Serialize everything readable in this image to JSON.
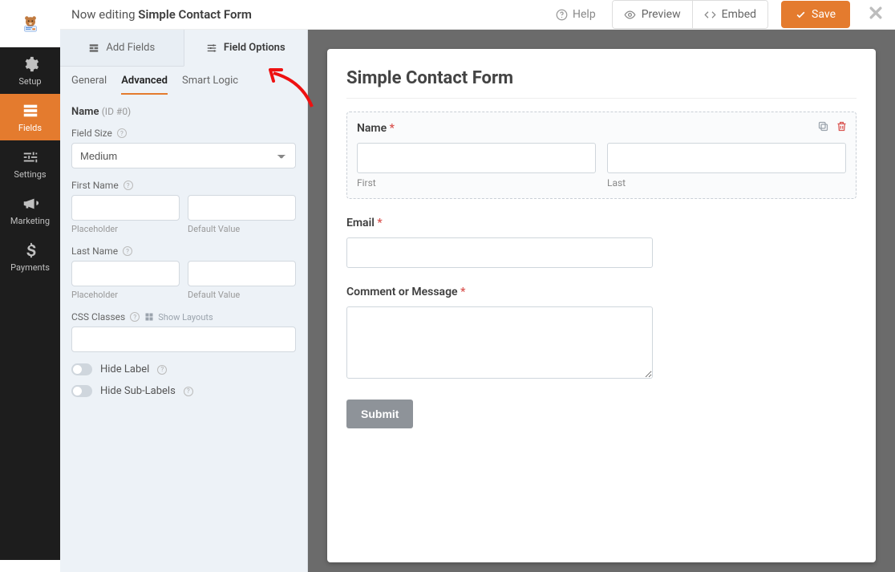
{
  "topbar": {
    "editing_prefix": "Now editing ",
    "form_name": "Simple Contact Form",
    "help": "Help",
    "preview": "Preview",
    "embed": "Embed",
    "save": "Save"
  },
  "rail": {
    "setup": "Setup",
    "fields": "Fields",
    "settings": "Settings",
    "marketing": "Marketing",
    "payments": "Payments"
  },
  "side": {
    "tab_add": "Add Fields",
    "tab_opts": "Field Options",
    "sub_general": "General",
    "sub_advanced": "Advanced",
    "sub_smart": "Smart Logic",
    "grp_name": "Name",
    "grp_idtag": "(ID #0)",
    "field_size": "Field Size",
    "field_size_value": "Medium",
    "first_name": "First Name",
    "last_name": "Last Name",
    "placeholder": "Placeholder",
    "default_value": "Default Value",
    "css_classes": "CSS Classes",
    "show_layouts": "Show Layouts",
    "hide_label": "Hide Label",
    "hide_sub": "Hide Sub-Labels"
  },
  "preview": {
    "title": "Simple Contact Form",
    "name_label": "Name",
    "first": "First",
    "last": "Last",
    "email_label": "Email",
    "comment_label": "Comment or Message",
    "submit": "Submit"
  }
}
